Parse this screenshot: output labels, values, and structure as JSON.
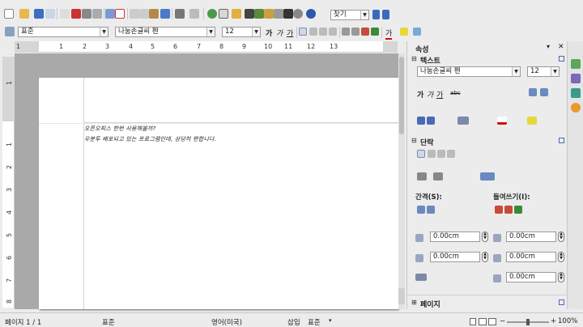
{
  "toolbar": {
    "find_value": "찾기",
    "paragraph_style": "표준",
    "font_name": "나눔손글씨 펜",
    "font_size": "12",
    "bold_glyph": "가",
    "italic_glyph": "가",
    "underline_glyph": "가"
  },
  "ruler": {
    "numbers": [
      "1",
      "1",
      "2",
      "3",
      "4",
      "5",
      "6",
      "7",
      "8",
      "9",
      "10",
      "11",
      "12",
      "13"
    ],
    "vnumbers": [
      "1",
      "1",
      "2",
      "3",
      "4",
      "5",
      "6",
      "7",
      "8"
    ]
  },
  "document": {
    "lines": [
      "오픈오피스 한번 사용해볼까?",
      "우분투 배포되고 있는 프로그램인데, 상당히 편합니다."
    ]
  },
  "sidebar": {
    "title": "속성",
    "text_section": {
      "title": "텍스트",
      "font_name": "나눔손글씨 펜",
      "font_size": "12",
      "bold": "가",
      "italic": "가",
      "underline": "가",
      "strike": "abc"
    },
    "paragraph_section": {
      "title": "단락",
      "spacing_label": "간격(S):",
      "indent_label": "들여쓰기(I):",
      "above": "0.00cm",
      "below": "0.00cm",
      "before": "0.00cm",
      "after": "0.00cm",
      "first_line": "0.00cm"
    },
    "page_section": {
      "title": "페이지"
    }
  },
  "status": {
    "page": "페이지 1 / 1",
    "style": "표준",
    "language": "영어(미국)",
    "mode": "삽입",
    "selection": "표준",
    "zoom": "100%"
  }
}
